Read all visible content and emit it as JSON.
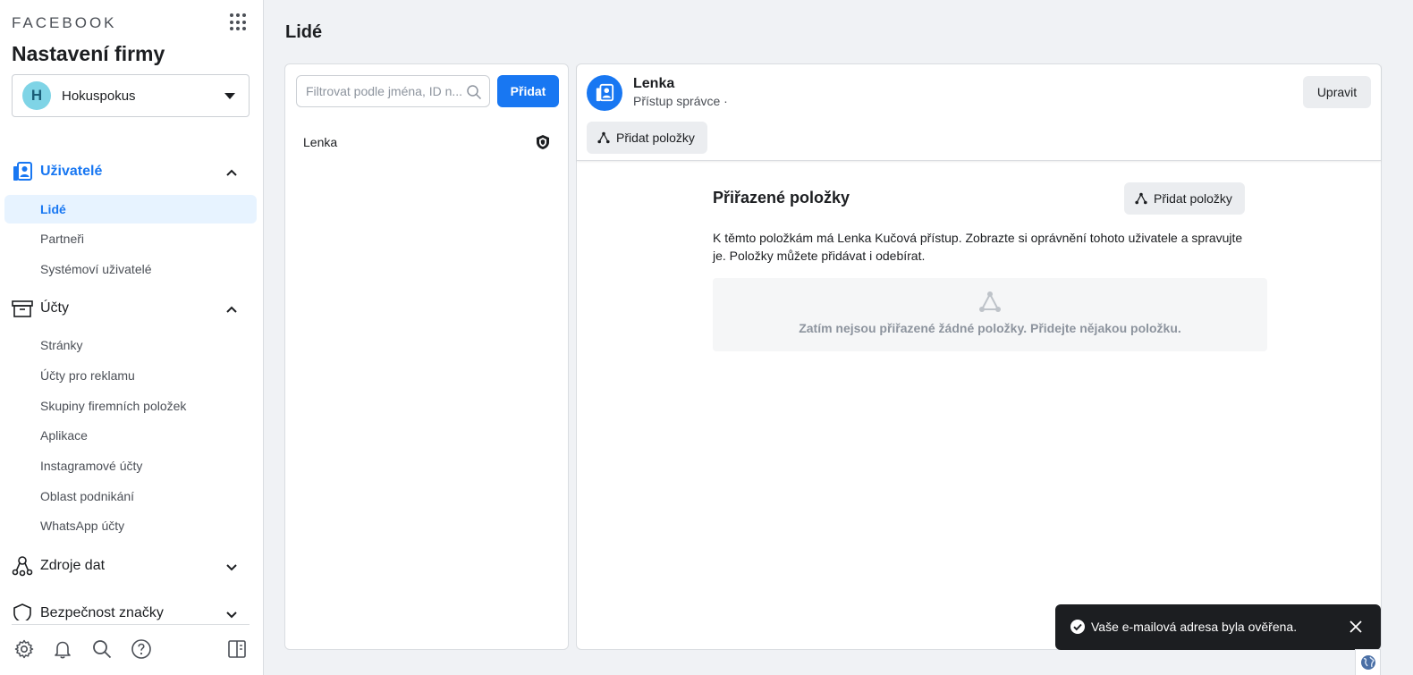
{
  "sidebar": {
    "brand": "FACEBOOK",
    "title": "Nastavení firmy",
    "business": {
      "initial": "H",
      "name": "Hokuspokus"
    },
    "sections": [
      {
        "label": "Uživatelé",
        "items": [
          "Lidé",
          "Partneři",
          "Systémoví uživatelé"
        ]
      },
      {
        "label": "Účty",
        "items": [
          "Stránky",
          "Účty pro reklamu",
          "Skupiny firemních položek",
          "Aplikace",
          "Instagramové účty",
          "Oblast podnikání",
          "WhatsApp účty"
        ]
      },
      {
        "label": "Zdroje dat"
      },
      {
        "label": "Bezpečnost značky"
      }
    ]
  },
  "main": {
    "page_title": "Lidé",
    "search": {
      "placeholder": "Filtrovat podle jména, ID n...",
      "value": ""
    },
    "add_label": "Přidat",
    "people": [
      {
        "name": "Lenka"
      }
    ]
  },
  "detail": {
    "name": "Lenka",
    "role": "Přístup správce ·",
    "edit_label": "Upravit",
    "add_items_label": "Přidat položky",
    "assigned_title": "Přiřazené položky",
    "assigned_add_label": "Přidat položky",
    "assigned_desc": "K těmto položkám má Lenka Kučová přístup. Zobrazte si oprávnění tohoto uživatele a spravujte je. Položky můžete přidávat i odebírat.",
    "empty_text": "Zatím nejsou přiřazené žádné položky. Přidejte nějakou položku."
  },
  "toast": {
    "text": "Vaše e-mailová adresa byla ověřena."
  },
  "colors": {
    "accent": "#1877f2",
    "toast_bg": "#1c1e21",
    "page_bg": "#f0f2f5"
  }
}
